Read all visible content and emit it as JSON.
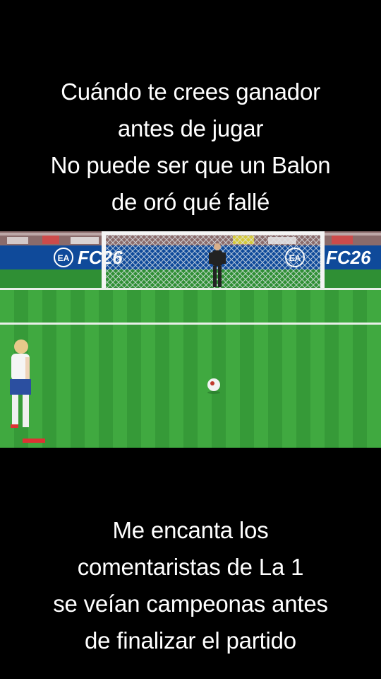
{
  "top_caption": {
    "lines": [
      "Cuándo te crees ganador",
      "antes de jugar",
      "No puede ser que un Balon",
      "de oró qué fallé"
    ]
  },
  "bottom_caption": {
    "lines": [
      "Me encanta los",
      "comentaristas de La 1",
      "se veían campeonas antes",
      "de finalizar el partido"
    ]
  },
  "video": {
    "ad_board_text_1": "FC26",
    "ad_board_text_2": "FC26",
    "ad_board_logo": "EA",
    "colors": {
      "pitch_light": "#3fa83f",
      "pitch_dark": "#2f8f34",
      "ad_board": "#0f4a9a",
      "stands": "#8a6b6b"
    }
  }
}
